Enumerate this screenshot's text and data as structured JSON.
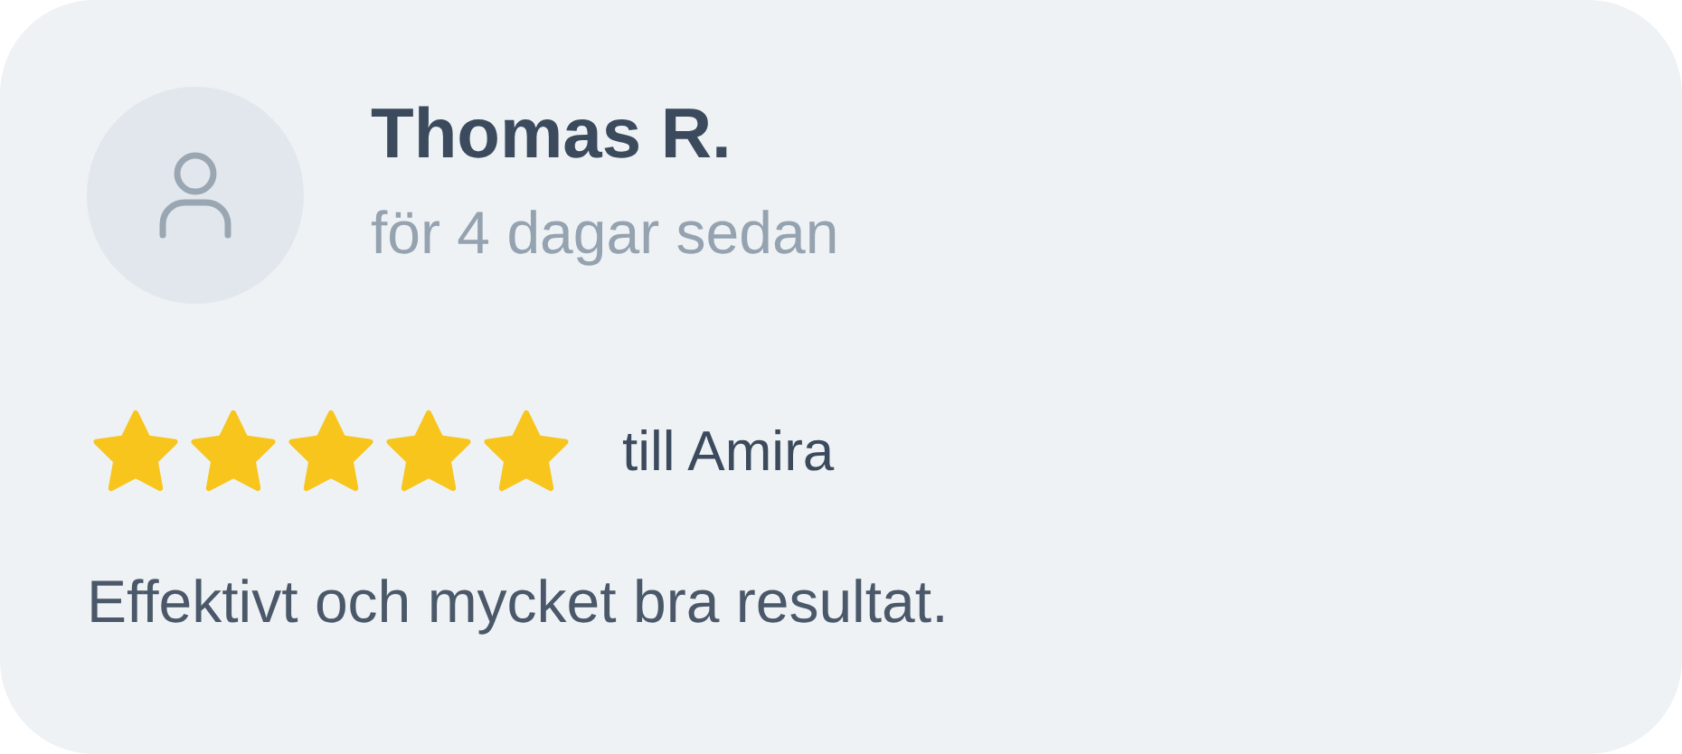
{
  "review": {
    "author": "Thomas R.",
    "time": "för 4 dagar sedan",
    "stars": 5,
    "recipient": "till Amira",
    "text": "Effektivt och mycket bra resultat."
  }
}
